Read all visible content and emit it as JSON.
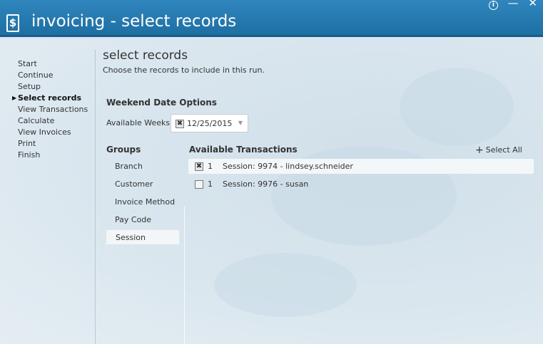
{
  "window": {
    "title": "invoicing - select records",
    "app_icon_glyph": "$",
    "controls": {
      "info_glyph": "i",
      "minimize_glyph": "—",
      "close_glyph": "✕"
    }
  },
  "nav": {
    "items": [
      {
        "label": "Start",
        "active": false
      },
      {
        "label": "Continue",
        "active": false
      },
      {
        "label": "Setup",
        "active": false
      },
      {
        "label": "Select records",
        "active": true
      },
      {
        "label": "View Transactions",
        "active": false
      },
      {
        "label": "Calculate",
        "active": false
      },
      {
        "label": "View Invoices",
        "active": false
      },
      {
        "label": "Print",
        "active": false
      },
      {
        "label": "Finish",
        "active": false
      }
    ]
  },
  "page": {
    "title": "select records",
    "subtitle": "Choose the records to include in this run."
  },
  "weekend": {
    "heading": "Weekend Date Options",
    "available_weeks_label": "Available Weeks",
    "selected_week": "12/25/2015",
    "selected_week_checked": true
  },
  "groups": {
    "heading": "Groups",
    "items": [
      "Branch",
      "Customer",
      "Invoice Method",
      "Pay Code",
      "Session"
    ],
    "selected": "Session"
  },
  "transactions": {
    "heading": "Available Transactions",
    "select_all_label": "Select All",
    "rows": [
      {
        "checked": true,
        "count": "1",
        "description": "Session: 9974 - lindsey.schneider"
      },
      {
        "checked": false,
        "count": "1",
        "description": "Session: 9976 - susan"
      }
    ]
  },
  "colors": {
    "titlebar": "#2179b0",
    "background": "#dbe7ef"
  }
}
